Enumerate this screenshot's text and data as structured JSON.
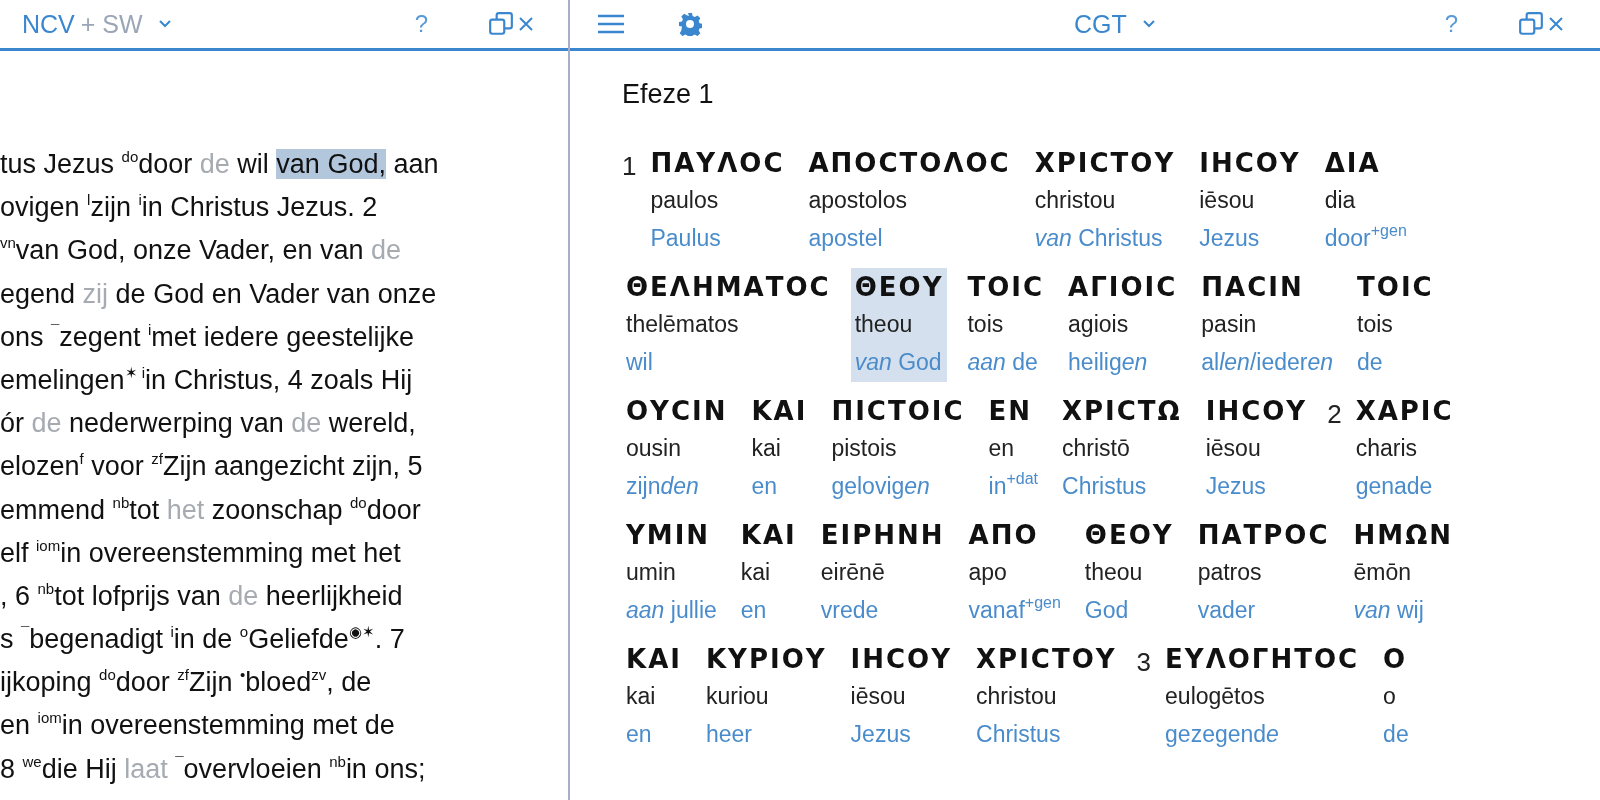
{
  "left_panel": {
    "translation": "NCV",
    "addition": "+ SW",
    "help": "?",
    "lines": [
      [
        {
          "kind": "text",
          "text": "tus Jezus "
        },
        {
          "kind": "sup",
          "text": "do"
        },
        {
          "kind": "text",
          "text": "door "
        },
        {
          "kind": "grey",
          "text": "de"
        },
        {
          "kind": "text",
          "text": " wil "
        },
        {
          "kind": "highlight",
          "text": "van God,"
        },
        {
          "kind": "text",
          "text": " aan"
        }
      ],
      [
        {
          "kind": "text",
          "text": "ovigen "
        },
        {
          "kind": "sup",
          "text": "l"
        },
        {
          "kind": "text",
          "text": "zijn "
        },
        {
          "kind": "sup",
          "text": "i"
        },
        {
          "kind": "text",
          "text": "in Christus Jezus. 2"
        }
      ],
      [
        {
          "kind": "sup",
          "text": "vn"
        },
        {
          "kind": "text",
          "text": "van God, onze Vader, en van "
        },
        {
          "kind": "grey",
          "text": "de"
        }
      ],
      [
        {
          "kind": "text",
          "text": "egend "
        },
        {
          "kind": "grey",
          "text": "zij"
        },
        {
          "kind": "text",
          "text": " de God en Vader van onze"
        }
      ],
      [
        {
          "kind": "text",
          "text": "ons "
        },
        {
          "kind": "sup",
          "text": "¯"
        },
        {
          "kind": "text",
          "text": "zegent "
        },
        {
          "kind": "sup",
          "text": "i"
        },
        {
          "kind": "text",
          "text": "met iedere geestelijke"
        }
      ],
      [
        {
          "kind": "text",
          "text": "emelingen"
        },
        {
          "kind": "sup",
          "text": "✶ "
        },
        {
          "kind": "sup",
          "text": "i"
        },
        {
          "kind": "text",
          "text": "in Christus, 4 zoals Hij"
        }
      ],
      [
        {
          "kind": "text",
          "text": "ór "
        },
        {
          "kind": "grey",
          "text": "de"
        },
        {
          "kind": "text",
          "text": " nederwerping van "
        },
        {
          "kind": "grey",
          "text": "de"
        },
        {
          "kind": "text",
          "text": " wereld,"
        }
      ],
      [
        {
          "kind": "text",
          "text": "elozen"
        },
        {
          "kind": "sup",
          "text": "f"
        },
        {
          "kind": "text",
          "text": " voor "
        },
        {
          "kind": "sup",
          "text": "zf"
        },
        {
          "kind": "text",
          "text": "Zijn aangezicht zijn, 5"
        }
      ],
      [
        {
          "kind": "text",
          "text": "emmend "
        },
        {
          "kind": "sup",
          "text": "nb"
        },
        {
          "kind": "text",
          "text": "tot "
        },
        {
          "kind": "grey",
          "text": "het"
        },
        {
          "kind": "text",
          "text": " zoonschap "
        },
        {
          "kind": "sup",
          "text": "do"
        },
        {
          "kind": "text",
          "text": "door"
        }
      ],
      [
        {
          "kind": "text",
          "text": "elf "
        },
        {
          "kind": "sup",
          "text": "iom"
        },
        {
          "kind": "text",
          "text": "in overeenstemming met het"
        }
      ],
      [
        {
          "kind": "text",
          "text": ", 6 "
        },
        {
          "kind": "sup",
          "text": "nb"
        },
        {
          "kind": "text",
          "text": "tot lofprijs van "
        },
        {
          "kind": "grey",
          "text": "de"
        },
        {
          "kind": "text",
          "text": " heerlijkheid"
        }
      ],
      [
        {
          "kind": "text",
          "text": "s "
        },
        {
          "kind": "sup",
          "text": "¯"
        },
        {
          "kind": "text",
          "text": "begenadigt "
        },
        {
          "kind": "sup",
          "text": "i"
        },
        {
          "kind": "text",
          "text": "in de "
        },
        {
          "kind": "sup",
          "text": "o"
        },
        {
          "kind": "text",
          "text": "Geliefde"
        },
        {
          "kind": "sup",
          "text": "◉✶"
        },
        {
          "kind": "text",
          "text": ". 7"
        }
      ],
      [
        {
          "kind": "text",
          "text": "ijkoping "
        },
        {
          "kind": "sup",
          "text": "do"
        },
        {
          "kind": "text",
          "text": "door "
        },
        {
          "kind": "sup",
          "text": "zf"
        },
        {
          "kind": "text",
          "text": "Zijn "
        },
        {
          "kind": "sup",
          "text": "•"
        },
        {
          "kind": "text",
          "text": "bloed"
        },
        {
          "kind": "sup",
          "text": "zv"
        },
        {
          "kind": "text",
          "text": ", de"
        }
      ],
      [
        {
          "kind": "text",
          "text": "en "
        },
        {
          "kind": "sup",
          "text": "iom"
        },
        {
          "kind": "text",
          "text": "in overeenstemming met de"
        }
      ],
      [
        {
          "kind": "text",
          "text": "8 "
        },
        {
          "kind": "sup",
          "text": "we"
        },
        {
          "kind": "text",
          "text": "die Hij "
        },
        {
          "kind": "grey",
          "text": "laat "
        },
        {
          "kind": "sup",
          "text": "¯"
        },
        {
          "kind": "text",
          "text": "overvloeien "
        },
        {
          "kind": "sup",
          "text": "nb"
        },
        {
          "kind": "text",
          "text": "in ons;"
        }
      ]
    ]
  },
  "right_panel": {
    "translation": "CGT",
    "help": "?",
    "heading": "Efeze 1",
    "lines": [
      [
        {
          "kind": "verse",
          "number": "1"
        },
        {
          "kind": "word",
          "greek": "ΠΑΥΛΟϹ",
          "translit": "paulos",
          "gloss": [
            {
              "kind": "plain",
              "text": "Paulus"
            }
          ],
          "selected": false
        },
        {
          "kind": "word",
          "greek": "ΑΠΟϹΤΟΛΟϹ",
          "translit": "apostolos",
          "gloss": [
            {
              "kind": "plain",
              "text": "apostel"
            }
          ],
          "selected": false
        },
        {
          "kind": "word",
          "greek": "ΧΡΙϹΤΟΥ",
          "translit": "christou",
          "gloss": [
            {
              "kind": "italic",
              "text": "van"
            },
            {
              "kind": "plain",
              "text": " Christus"
            }
          ],
          "selected": false
        },
        {
          "kind": "word",
          "greek": "ΙΗϹΟΥ",
          "translit": "iēsou",
          "gloss": [
            {
              "kind": "plain",
              "text": "Jezus"
            }
          ],
          "selected": false
        },
        {
          "kind": "word",
          "greek": "ΔΙΑ",
          "translit": "dia",
          "gloss": [
            {
              "kind": "plain",
              "text": "door"
            },
            {
              "kind": "sup",
              "text": "+gen"
            }
          ],
          "selected": false
        }
      ],
      [
        {
          "kind": "word",
          "greek": "ΘΕΛΗΜΑΤΟϹ",
          "translit": "thelēmatos",
          "gloss": [
            {
              "kind": "plain",
              "text": "wil"
            }
          ],
          "selected": false
        },
        {
          "kind": "word",
          "greek": "ΘΕΟΥ",
          "translit": "theou",
          "gloss": [
            {
              "kind": "italic",
              "text": "van"
            },
            {
              "kind": "plain",
              "text": " God"
            }
          ],
          "selected": true
        },
        {
          "kind": "word",
          "greek": "ΤΟΙϹ",
          "translit": "tois",
          "gloss": [
            {
              "kind": "italic",
              "text": "aan"
            },
            {
              "kind": "plain",
              "text": " de"
            }
          ],
          "selected": false
        },
        {
          "kind": "word",
          "greek": "ΑΓΙΟΙϹ",
          "translit": "agiois",
          "gloss": [
            {
              "kind": "plain",
              "text": "heilig"
            },
            {
              "kind": "italic",
              "text": "en"
            }
          ],
          "selected": false
        },
        {
          "kind": "word",
          "greek": "ΠΑϹΙΝ",
          "translit": "pasin",
          "gloss": [
            {
              "kind": "plain",
              "text": "al"
            },
            {
              "kind": "italic",
              "text": "len"
            },
            {
              "kind": "plain",
              "text": "/ieder"
            },
            {
              "kind": "italic",
              "text": "en"
            }
          ],
          "selected": false
        },
        {
          "kind": "word",
          "greek": "ΤΟΙϹ",
          "translit": "tois",
          "gloss": [
            {
              "kind": "plain",
              "text": "de"
            }
          ],
          "selected": false
        }
      ],
      [
        {
          "kind": "word",
          "greek": "ΟΥϹΙΝ",
          "translit": "ousin",
          "gloss": [
            {
              "kind": "plain",
              "text": "zijn"
            },
            {
              "kind": "italic",
              "text": "den"
            }
          ],
          "selected": false
        },
        {
          "kind": "word",
          "greek": "ΚΑΙ",
          "translit": "kai",
          "gloss": [
            {
              "kind": "plain",
              "text": "en"
            }
          ],
          "selected": false
        },
        {
          "kind": "word",
          "greek": "ΠΙϹΤΟΙϹ",
          "translit": "pistois",
          "gloss": [
            {
              "kind": "plain",
              "text": "gelovig"
            },
            {
              "kind": "italic",
              "text": "en"
            }
          ],
          "selected": false
        },
        {
          "kind": "word",
          "greek": "ΕΝ",
          "translit": "en",
          "gloss": [
            {
              "kind": "plain",
              "text": "in"
            },
            {
              "kind": "sup",
              "text": "+dat"
            }
          ],
          "selected": false
        },
        {
          "kind": "word",
          "greek": "ΧΡΙϹΤΩ",
          "translit": "christō",
          "gloss": [
            {
              "kind": "plain",
              "text": "Christus"
            }
          ],
          "selected": false
        },
        {
          "kind": "word",
          "greek": "ΙΗϹΟΥ",
          "translit": "iēsou",
          "gloss": [
            {
              "kind": "plain",
              "text": "Jezus"
            }
          ],
          "selected": false
        },
        {
          "kind": "verse",
          "number": "2"
        },
        {
          "kind": "word",
          "greek": "ΧΑΡΙϹ",
          "translit": "charis",
          "gloss": [
            {
              "kind": "plain",
              "text": "genade"
            }
          ],
          "selected": false
        }
      ],
      [
        {
          "kind": "word",
          "greek": "ΥΜΙΝ",
          "translit": "umin",
          "gloss": [
            {
              "kind": "italic",
              "text": "aan"
            },
            {
              "kind": "plain",
              "text": " jullie"
            }
          ],
          "selected": false
        },
        {
          "kind": "word",
          "greek": "ΚΑΙ",
          "translit": "kai",
          "gloss": [
            {
              "kind": "plain",
              "text": "en"
            }
          ],
          "selected": false
        },
        {
          "kind": "word",
          "greek": "ΕΙΡΗΝΗ",
          "translit": "eirēnē",
          "gloss": [
            {
              "kind": "plain",
              "text": "vrede"
            }
          ],
          "selected": false
        },
        {
          "kind": "word",
          "greek": "ΑΠΟ",
          "translit": "apo",
          "gloss": [
            {
              "kind": "plain",
              "text": "vanaf"
            },
            {
              "kind": "sup",
              "text": "+gen"
            }
          ],
          "selected": false
        },
        {
          "kind": "word",
          "greek": "ΘΕΟΥ",
          "translit": "theou",
          "gloss": [
            {
              "kind": "plain",
              "text": "God"
            }
          ],
          "selected": false
        },
        {
          "kind": "word",
          "greek": "ΠΑΤΡΟϹ",
          "translit": "patros",
          "gloss": [
            {
              "kind": "plain",
              "text": "vader"
            }
          ],
          "selected": false
        },
        {
          "kind": "word",
          "greek": "ΗΜΩΝ",
          "translit": "ēmōn",
          "gloss": [
            {
              "kind": "italic",
              "text": "van"
            },
            {
              "kind": "plain",
              "text": " wij"
            }
          ],
          "selected": false
        }
      ],
      [
        {
          "kind": "word",
          "greek": "ΚΑΙ",
          "translit": "kai",
          "gloss": [
            {
              "kind": "plain",
              "text": "en"
            }
          ],
          "selected": false
        },
        {
          "kind": "word",
          "greek": "ΚΥΡΙΟΥ",
          "translit": "kuriou",
          "gloss": [
            {
              "kind": "plain",
              "text": "heer"
            }
          ],
          "selected": false
        },
        {
          "kind": "word",
          "greek": "ΙΗϹΟΥ",
          "translit": "iēsou",
          "gloss": [
            {
              "kind": "plain",
              "text": "Jezus"
            }
          ],
          "selected": false
        },
        {
          "kind": "word",
          "greek": "ΧΡΙϹΤΟΥ",
          "translit": "christou",
          "gloss": [
            {
              "kind": "plain",
              "text": "Christus"
            }
          ],
          "selected": false
        },
        {
          "kind": "verse",
          "number": "3"
        },
        {
          "kind": "word",
          "greek": "ΕΥΛΟΓΗΤΟϹ",
          "translit": "eulogētos",
          "gloss": [
            {
              "kind": "plain",
              "text": "gezegend"
            },
            {
              "kind": "italic",
              "text": "e"
            }
          ],
          "selected": false
        },
        {
          "kind": "word",
          "greek": "Ο",
          "translit": "o",
          "gloss": [
            {
              "kind": "plain",
              "text": "de"
            }
          ],
          "selected": false
        }
      ]
    ]
  }
}
